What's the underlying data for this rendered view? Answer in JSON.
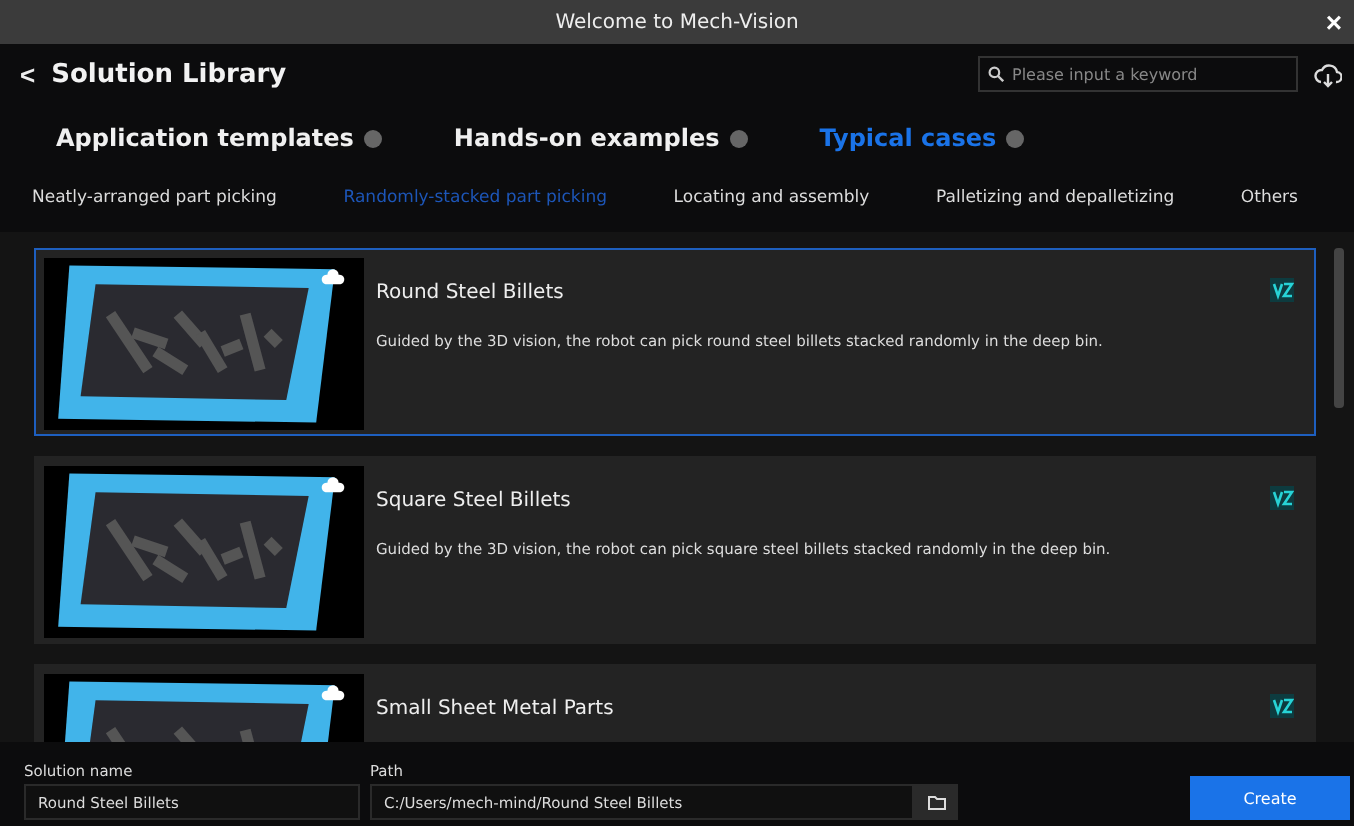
{
  "window": {
    "title": "Welcome to Mech-Vision",
    "close": "×"
  },
  "header": {
    "back": "<",
    "title": "Solution Library",
    "search": {
      "placeholder": "Please input a keyword"
    }
  },
  "tabs": [
    {
      "label": "Application templates",
      "selected": false
    },
    {
      "label": "Hands-on examples",
      "selected": false
    },
    {
      "label": "Typical cases",
      "selected": true
    }
  ],
  "categories": [
    {
      "label": "Neatly-arranged part picking",
      "selected": false
    },
    {
      "label": "Randomly-stacked part picking",
      "selected": true
    },
    {
      "label": "Locating and assembly",
      "selected": false
    },
    {
      "label": "Palletizing and depalletizing",
      "selected": false
    },
    {
      "label": "Others",
      "selected": false
    }
  ],
  "solutions": [
    {
      "title": "Round Steel Billets",
      "description": "Guided by the 3D vision, the robot can pick round steel billets stacked randomly in the deep bin.",
      "selected": true
    },
    {
      "title": "Square Steel Billets",
      "description": "Guided by the 3D vision, the robot can pick square steel billets stacked randomly in the deep bin.",
      "selected": false
    },
    {
      "title": "Small Sheet Metal Parts",
      "selected": false
    }
  ],
  "footer": {
    "name_label": "Solution name",
    "name_value": "Round Steel Billets",
    "path_label": "Path",
    "path_value": "C:/Users/mech-mind/Round Steel Billets",
    "create": "Create"
  }
}
